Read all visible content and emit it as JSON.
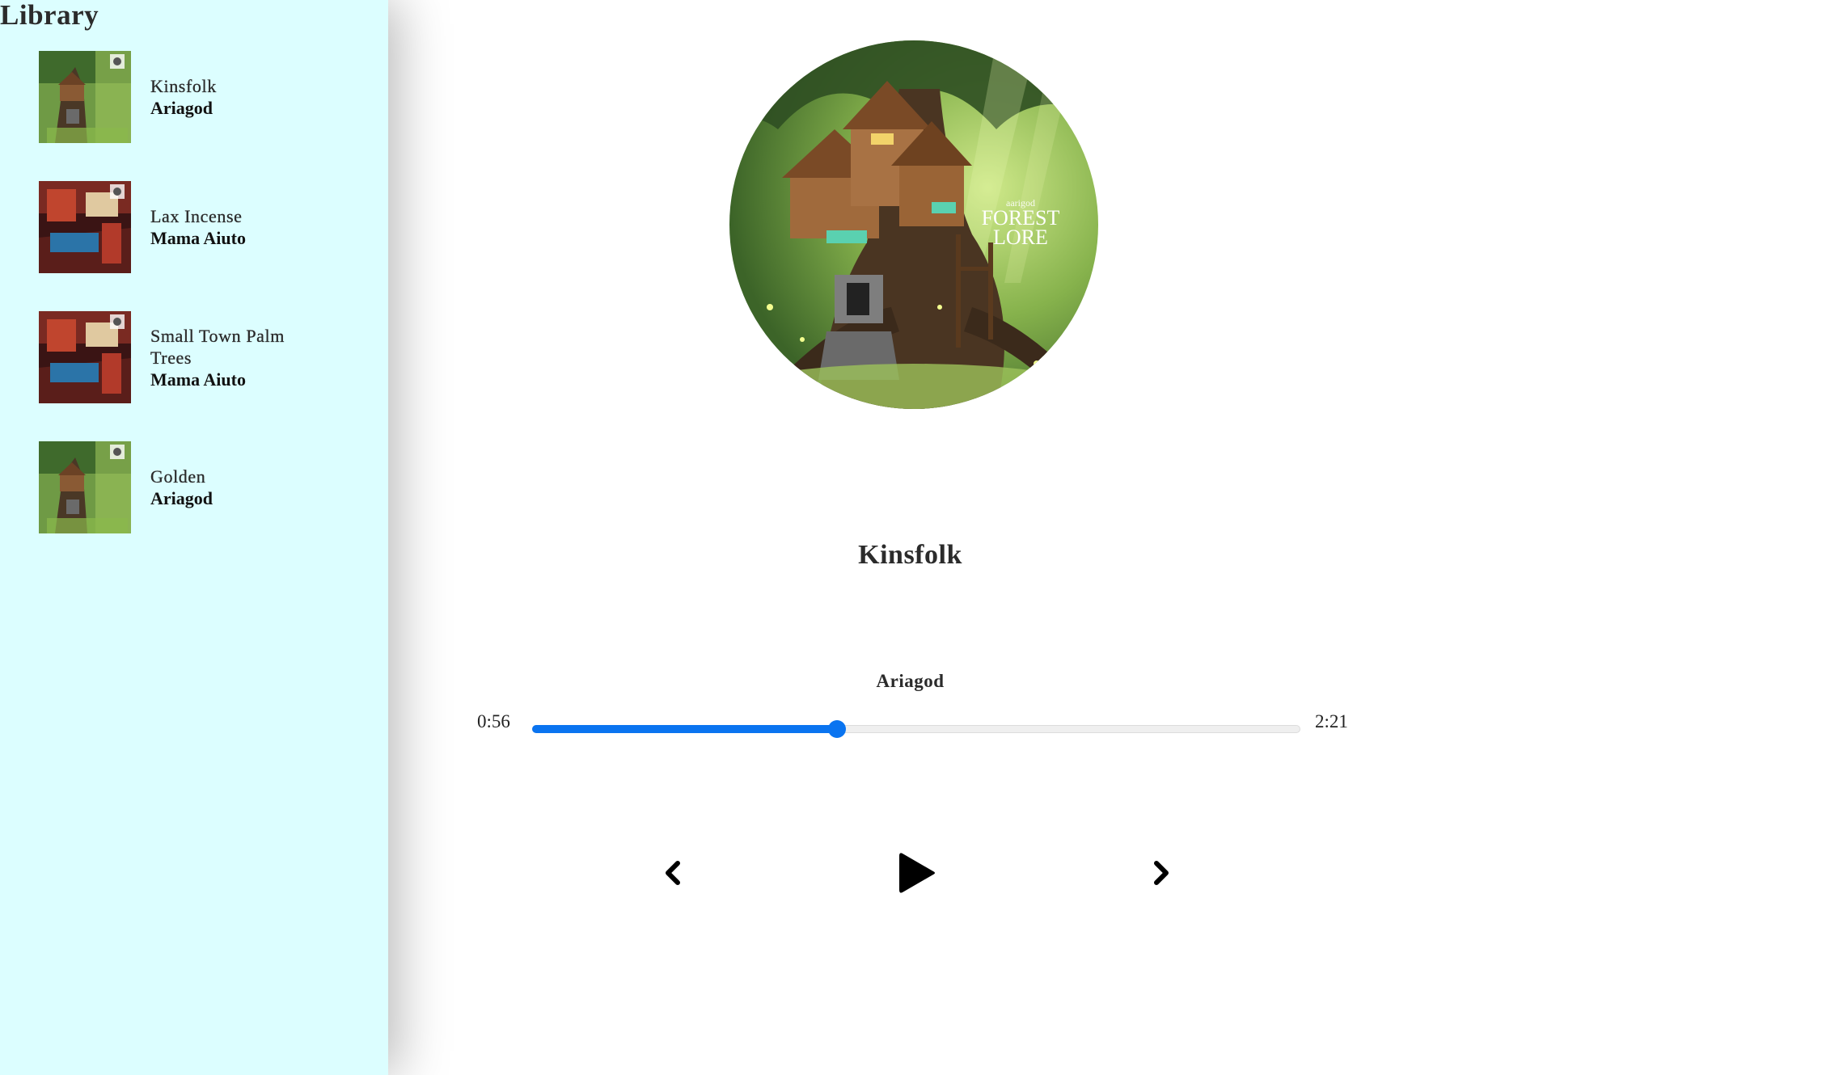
{
  "library": {
    "title": "Library",
    "songs": [
      {
        "name": "Kinsfolk",
        "artist": "Ariagod",
        "cover": "forest-lore-art"
      },
      {
        "name": "Lax Incense",
        "artist": "Mama Aiuto",
        "cover": "red-room-art"
      },
      {
        "name": "Small Town Palm Trees",
        "artist": "Mama Aiuto",
        "cover": "red-room-art"
      },
      {
        "name": "Golden",
        "artist": "Ariagod",
        "cover": "forest-lore-art"
      }
    ]
  },
  "player": {
    "cover_text": {
      "small": "aarigod",
      "line1": "FOREST",
      "line2": "LORE"
    },
    "track_title": "Kinsfolk",
    "track_artist": "Ariagod",
    "current_time": "0:56",
    "total_time": "2:21",
    "progress": 0.397,
    "controls": {
      "prev_icon": "chevron-left-icon",
      "play_icon": "play-icon",
      "next_icon": "chevron-right-icon"
    }
  },
  "colors": {
    "sidebar_bg": "#dcfeff",
    "accent": "#0a74f0",
    "track_bg": "#efefef"
  }
}
